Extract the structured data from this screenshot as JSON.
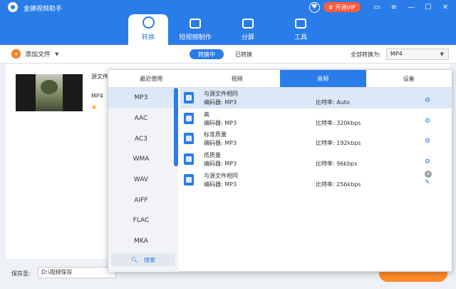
{
  "app": {
    "title": "金狮视频助手"
  },
  "header": {
    "vip_label": "开通VIP",
    "heart_icon": "heart-icon"
  },
  "main_tabs": [
    {
      "label": "转换",
      "icon": "convert-icon",
      "active": true
    },
    {
      "label": "短视频制作",
      "icon": "image-icon",
      "active": false
    },
    {
      "label": "分屏",
      "icon": "split-screen-icon",
      "active": false
    },
    {
      "label": "工具",
      "icon": "toolbox-icon",
      "active": false
    }
  ],
  "toolbar": {
    "add_file_label": "添加文件",
    "seg_converting": "转换中",
    "seg_converted": "已转换",
    "convert_all_label": "全部转换为:",
    "convert_all_value": "MP4"
  },
  "file": {
    "source_label": "源文件",
    "format_label": "MP4"
  },
  "bottom": {
    "save_label": "保存至:",
    "save_path": "D:\\视频保存"
  },
  "popup": {
    "tabs": [
      {
        "label": "最近使用",
        "active": false
      },
      {
        "label": "视频",
        "active": false
      },
      {
        "label": "音频",
        "active": true
      },
      {
        "label": "设备",
        "active": false
      }
    ],
    "formats": [
      "MP3",
      "AAC",
      "AC3",
      "WMA",
      "WAV",
      "AIFF",
      "FLAC",
      "MKA"
    ],
    "selected_format": "MP3",
    "search_label": "搜索",
    "codec_prefix": "编码器:",
    "bitrate_prefix": "比特率:",
    "options": [
      {
        "name": "与源文件相同",
        "codec": "MP3",
        "bitrate": "Auto",
        "active": true
      },
      {
        "name": "高",
        "codec": "MP3",
        "bitrate": "320kbps",
        "active": false
      },
      {
        "name": "标准质量",
        "codec": "MP3",
        "bitrate": "192kbps",
        "active": false
      },
      {
        "name": "低质量",
        "codec": "MP3",
        "bitrate": "96kbps",
        "active": false
      },
      {
        "name": "与源文件相同",
        "codec": "MP3",
        "bitrate": "256kbps",
        "active": false
      }
    ]
  },
  "colors": {
    "accent": "#2a7ce8",
    "orange": "#ff8a2a",
    "selected_bg": "#dce8f8"
  }
}
